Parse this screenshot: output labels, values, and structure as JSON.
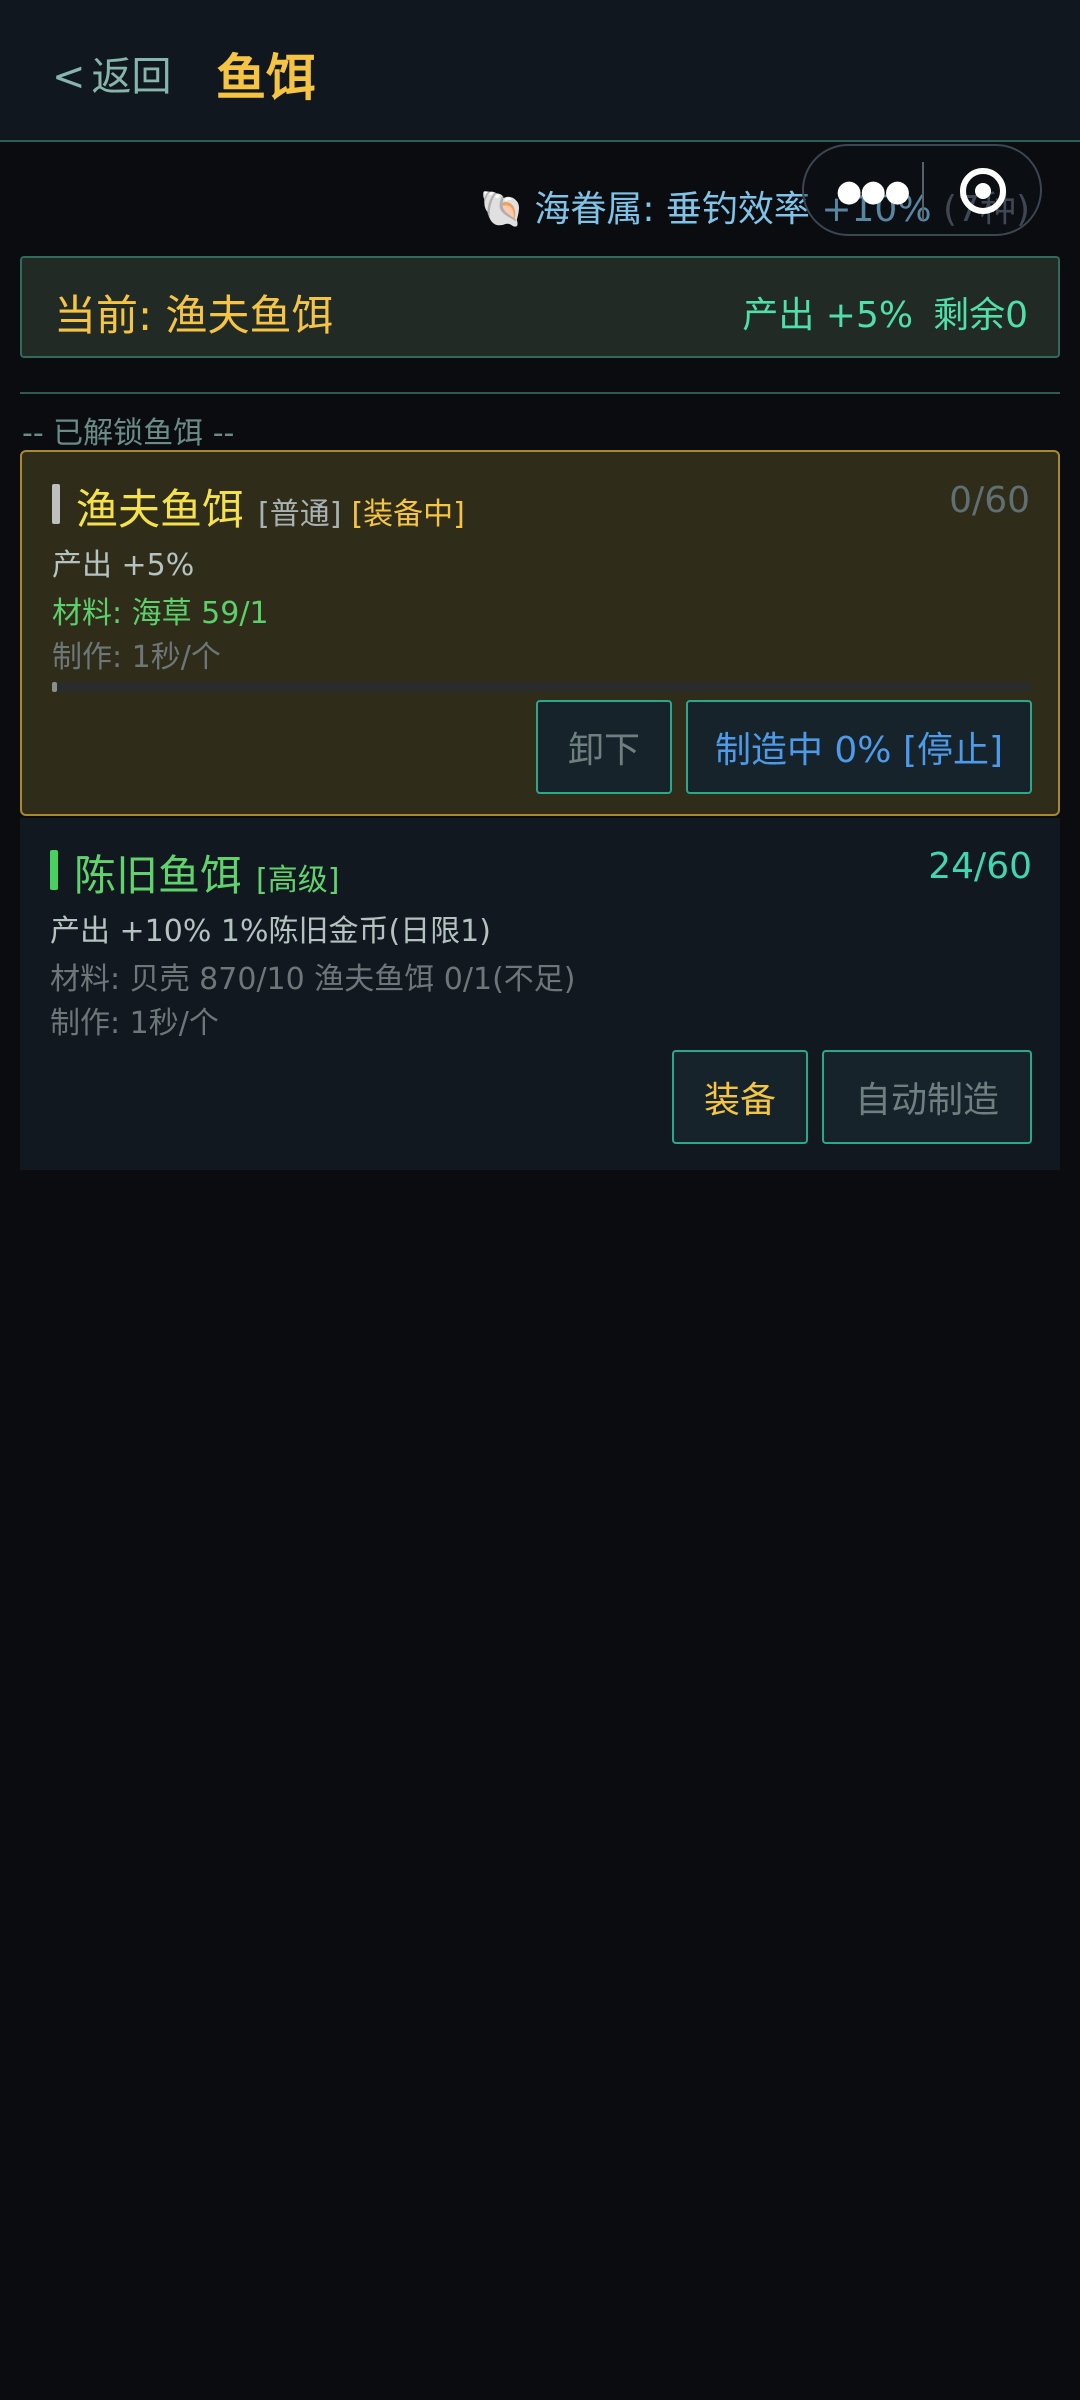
{
  "header": {
    "back_chevron": "<",
    "back_label": "返回",
    "title": "鱼饵"
  },
  "capsule": {
    "more_icon": "more-dots-icon",
    "close_icon": "target-icon"
  },
  "blessing": {
    "icon": "shell-icon",
    "icon_glyph": "🐚",
    "text": "海眷属: 垂钓效率 +10%",
    "suffix": "(7种)"
  },
  "current": {
    "label": "当前: 渔夫鱼饵",
    "output": "产出 +5%",
    "remaining": "剩余0"
  },
  "section": {
    "label": "-- 已解锁鱼饵 --"
  },
  "baits": [
    {
      "name": "渔夫鱼饵",
      "rarity": "[普通]",
      "status": "[装备中]",
      "count": "0/60",
      "output": "产出 +5%",
      "material": "材料: 海草 59/1",
      "craft_time": "制作: 1秒/个",
      "progress": 0.005,
      "unequip_label": "卸下",
      "crafting_label": "制造中 0% [停止]"
    },
    {
      "name": "陈旧鱼饵",
      "rarity": "[高级]",
      "count": "24/60",
      "output": "产出 +10%  1%陈旧金币(日限1)",
      "material": "材料: 贝壳 870/10  渔夫鱼饵 0/1(不足)",
      "craft_time": "制作: 1秒/个",
      "equip_label": "装备",
      "auto_craft_label": "自动制造"
    }
  ],
  "colors": {
    "accent_gold": "#f5c542",
    "accent_green": "#4fe0a8",
    "accent_blue": "#4d9be8",
    "border_teal": "#2aa88a"
  }
}
